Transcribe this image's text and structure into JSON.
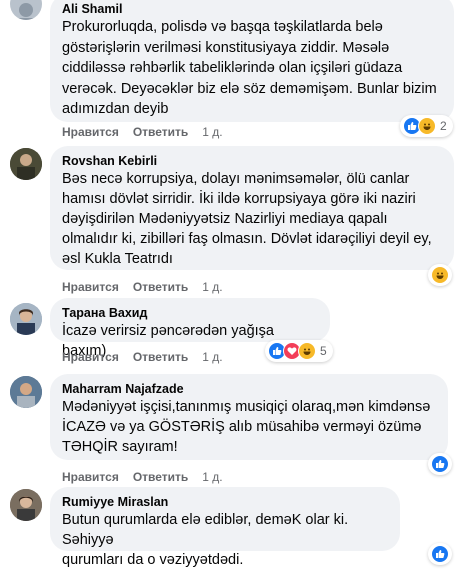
{
  "ui": {
    "like_label": "Нравится",
    "reply_label": "Ответить",
    "time_label": "1 д."
  },
  "comments": [
    {
      "author": "Ali Shamil",
      "text": "Prokurorluqda, polisdə və başqa təşkilatlarda belə\ngöstərişlərin verilməsi konstitusiyaya ziddir. Məsələ\nciddiləssə rəhbərlik tabeliklərində olan içşiləri güdaza\nverəcək. Deyəcəklər biz elə söz deməmişəm. Bunlar bizim\nadımızdan deyib",
      "reactions": [
        "like",
        "haha"
      ],
      "reaction_count": "2"
    },
    {
      "author": "Rovshan Kebirli",
      "text": "Bəs necə korrupsiya, dolayı mənimsəmələr, ölü canlar\nhamısı dövlət sirridir. İki ildə korrupsiyaya görə iki naziri\ndəyişdirilən Mədəniyyətsiz Nazirliyi mediaya qapalı\nolmalıdır ki, zibilləri faş olmasın. Dövlət idarəçiliyi deyil ey,\nəsl Kukla Teatrıdı",
      "reactions": [
        "haha"
      ],
      "reaction_count": ""
    },
    {
      "author": "Тарана Вахид",
      "text": "İcazə verirsiz pəncərədən yağışa baxım)",
      "reactions": [
        "like",
        "love",
        "haha"
      ],
      "reaction_count": "5"
    },
    {
      "author": "Maharram Najafzade",
      "text": "Mədəniyyət işçisi,tanınmış musiqiçi olaraq,mən kimdənsə\nİCAZƏ və ya GÖSTƏRİŞ alıb müsahibə verməyi özümə\nTƏHQİR sayıram!",
      "reactions": [
        "like"
      ],
      "reaction_count": ""
    },
    {
      "author": "Rumiyye Miraslan",
      "text": "Butun qurumlarda elə ediblər, deməK olar ki. Səhiyyə\nqurumları da o vəziyyətdədi.",
      "reactions": [
        "like"
      ],
      "reaction_count": ""
    }
  ]
}
